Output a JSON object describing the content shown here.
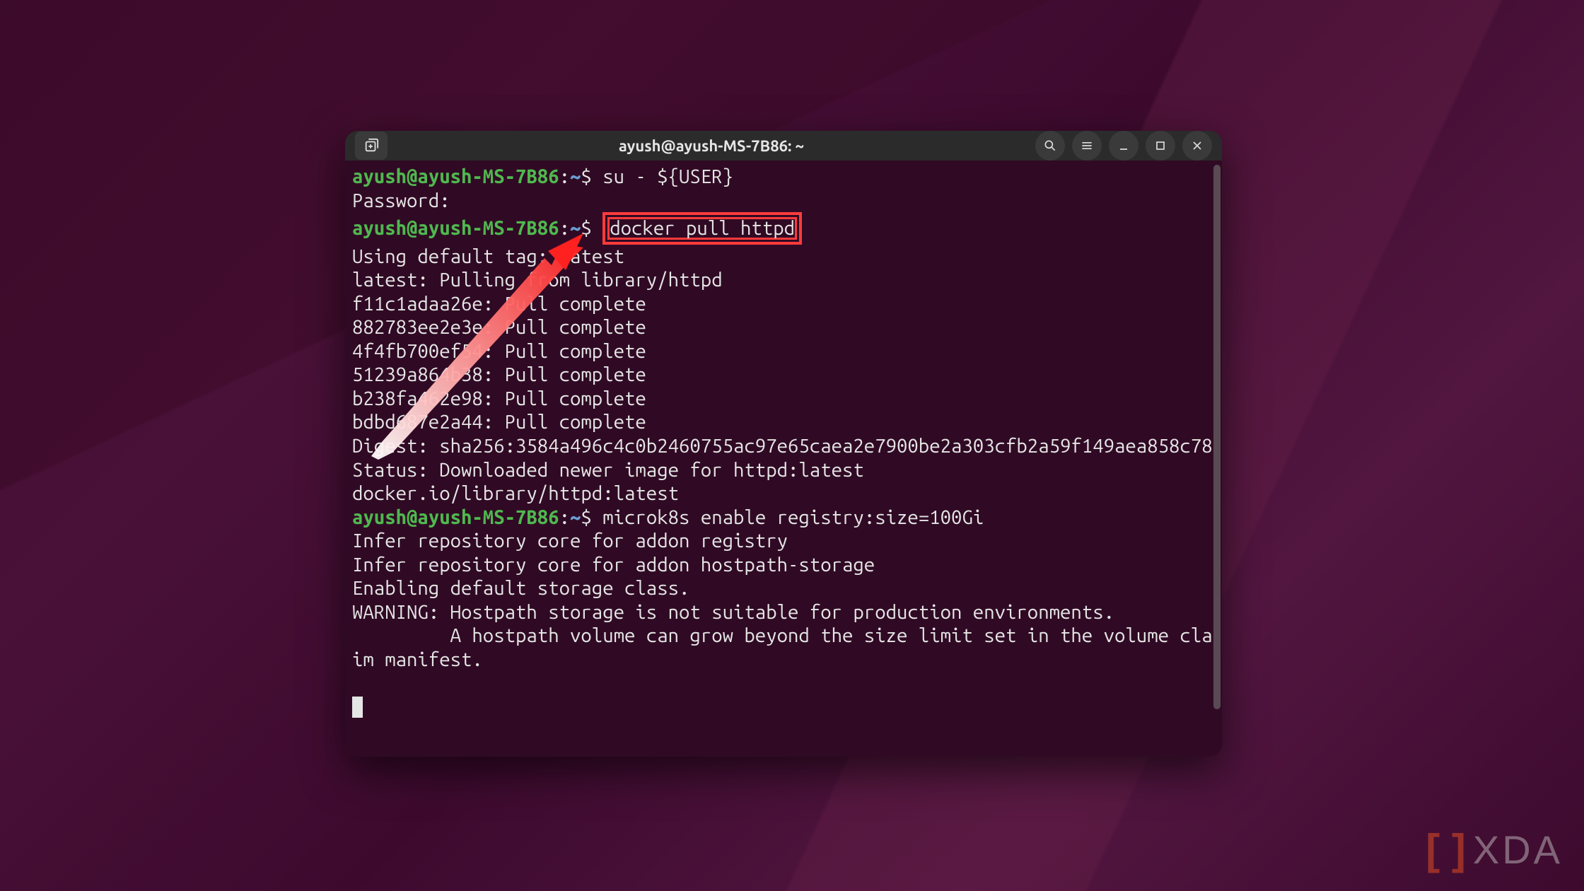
{
  "window": {
    "title": "ayush@ayush-MS-7B86: ~"
  },
  "prompt": {
    "user_host": "ayush@ayush-MS-7B86",
    "path": "~",
    "sep": ":",
    "dollar": "$"
  },
  "commands": {
    "su": "su - ${USER}",
    "docker_pull": "docker pull httpd",
    "microk8s": "microk8s enable registry:size=100Gi"
  },
  "output": {
    "password": "Password: ",
    "using_tag": "Using default tag: latest",
    "pulling": "latest: Pulling from library/httpd",
    "layer1": "f11c1adaa26e: Pull complete ",
    "layer2": "882783ee2e3e: Pull complete ",
    "layer3": "4f4fb700ef54: Pull complete ",
    "layer4": "51239a864b38: Pull complete ",
    "layer5": "b238fa462e98: Pull complete ",
    "layer6": "bdbd687e2a44: Pull complete ",
    "digest": "Digest: sha256:3584a496c4c0b2460755ac97e65caea2e7900be2a303cfb2a59f149aea858c78",
    "status": "Status: Downloaded newer image for httpd:latest",
    "image_ref": "docker.io/library/httpd:latest",
    "infer1": "Infer repository core for addon registry",
    "infer2": "Infer repository core for addon hostpath-storage",
    "enabling": "Enabling default storage class.",
    "warning1": "WARNING: Hostpath storage is not suitable for production environments.",
    "warning2": "         A hostpath volume can grow beyond the size limit set in the volume claim manifest."
  },
  "watermark": {
    "bracket": "[ ]",
    "text": "XDA"
  }
}
